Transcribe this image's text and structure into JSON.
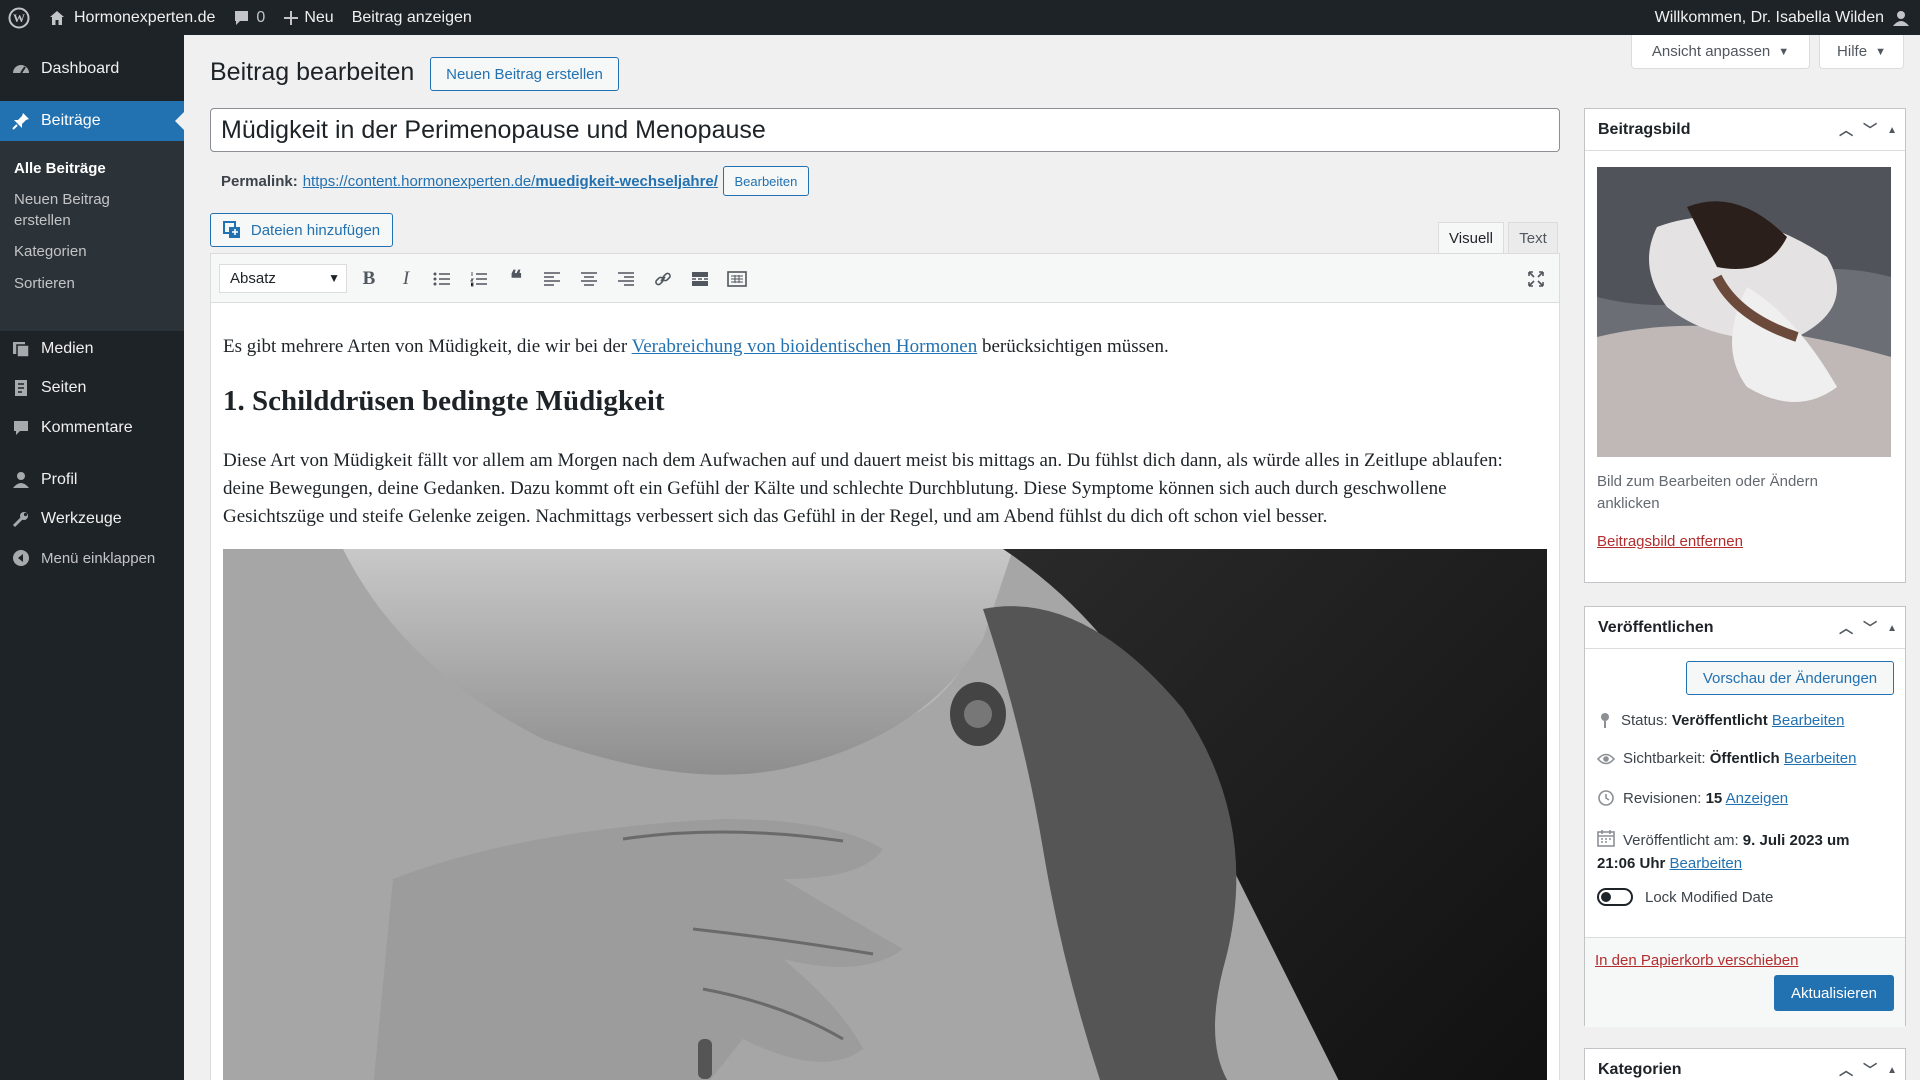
{
  "adminbar": {
    "site_name": "Hormonexperten.de",
    "comments_count": "0",
    "new_label": "Neu",
    "view_post_label": "Beitrag anzeigen",
    "greeting": "Willkommen, Dr. Isabella Wilden"
  },
  "sidebar": {
    "items": [
      {
        "label": "Dashboard",
        "icon": "dashboard-icon"
      },
      {
        "label": "Beiträge",
        "icon": "pin-icon"
      },
      {
        "label": "Medien",
        "icon": "media-icon"
      },
      {
        "label": "Seiten",
        "icon": "pages-icon"
      },
      {
        "label": "Kommentare",
        "icon": "comment-icon"
      },
      {
        "label": "Profil",
        "icon": "user-icon"
      },
      {
        "label": "Werkzeuge",
        "icon": "wrench-icon"
      },
      {
        "label": "Menü einklappen",
        "icon": "collapse-icon"
      }
    ],
    "submenu": [
      "Alle Beiträge",
      "Neuen Beitrag erstellen",
      "Kategorien",
      "Sortieren"
    ]
  },
  "header": {
    "title": "Beitrag bearbeiten",
    "new_post_button": "Neuen Beitrag erstellen",
    "screen_options": "Ansicht anpassen",
    "help": "Hilfe"
  },
  "post": {
    "title": "Müdigkeit in der Perimenopause und Menopause",
    "permalink_label": "Permalink:",
    "permalink_base": "https://content.hormonexperten.de/",
    "permalink_slug": "muedigkeit-wechseljahre/",
    "permalink_edit": "Bearbeiten"
  },
  "editor": {
    "add_media": "Dateien hinzufügen",
    "tab_visual": "Visuell",
    "tab_text": "Text",
    "format": "Absatz",
    "p1_before": "Es gibt mehrere Arten von Müdigkeit, die wir bei der ",
    "p1_link": "Verabreichung von bioidentischen Hormonen",
    "p1_after": " berücksichtigen müssen.",
    "heading": "1. Schilddrüsen bedingte Müdigkeit",
    "p2": "Diese Art von Müdigkeit fällt vor allem am Morgen nach dem Aufwachen auf und dauert meist bis mittags an. Du fühlst dich dann, als würde alles in Zeitlupe ablaufen: deine Bewegungen, deine Gedanken. Dazu kommt oft ein Gefühl der Kälte und schlechte Durchblutung. Diese Symptome können sich auch durch geschwollene Gesichtszüge und steife Gelenke zeigen. Nachmittags verbessert sich das Gefühl in der Regel, und am Abend fühlst du dich oft schon viel besser."
  },
  "featured_image": {
    "title": "Beitragsbild",
    "hint": "Bild zum Bearbeiten oder Ändern anklicken",
    "remove": "Beitragsbild entfernen"
  },
  "publish": {
    "title": "Veröffentlichen",
    "preview": "Vorschau der Änderungen",
    "status_label": "Status:",
    "status_value": "Veröffentlicht",
    "visibility_label": "Sichtbarkeit:",
    "visibility_value": "Öffentlich",
    "revisions_label": "Revisionen:",
    "revisions_value": "15",
    "revisions_link": "Anzeigen",
    "published_label": "Veröffentlicht am:",
    "published_value_1": "9. Juli 2023 um",
    "published_value_2": "21:06 Uhr",
    "edit": "Bearbeiten",
    "lock_label": "Lock Modified Date",
    "trash": "In den Papierkorb verschieben",
    "update": "Aktualisieren"
  },
  "categories": {
    "title": "Kategorien"
  },
  "colors": {
    "accent": "#2271b1",
    "adminbar": "#1d2327",
    "danger": "#b32d2e"
  }
}
